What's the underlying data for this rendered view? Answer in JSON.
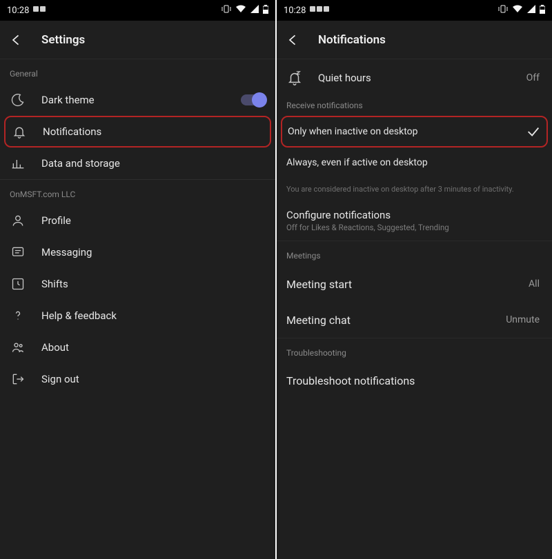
{
  "status": {
    "time": "10:28"
  },
  "left": {
    "title": "Settings",
    "section_general": "General",
    "dark_theme": "Dark theme",
    "notifications": "Notifications",
    "data_storage": "Data and storage",
    "section_org": "OnMSFT.com LLC",
    "profile": "Profile",
    "messaging": "Messaging",
    "shifts": "Shifts",
    "help": "Help & feedback",
    "about": "About",
    "sign_out": "Sign out"
  },
  "right": {
    "title": "Notifications",
    "quiet_hours": "Quiet hours",
    "quiet_hours_value": "Off",
    "section_receive": "Receive notifications",
    "only_inactive": "Only when inactive on desktop",
    "always": "Always, even if active on desktop",
    "inactive_note": "You are considered inactive on desktop after 3 minutes of inactivity.",
    "configure": "Configure notifications",
    "configure_sub": "Off for Likes & Reactions, Suggested, Trending",
    "section_meetings": "Meetings",
    "meeting_start": "Meeting start",
    "meeting_start_value": "All",
    "meeting_chat": "Meeting chat",
    "meeting_chat_value": "Unmute",
    "section_troubleshooting": "Troubleshooting",
    "troubleshoot": "Troubleshoot notifications"
  }
}
